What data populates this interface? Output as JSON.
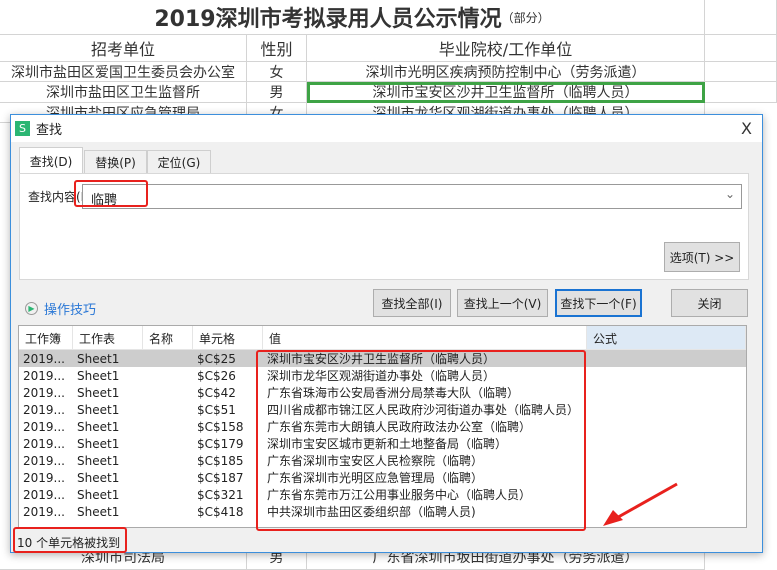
{
  "sheet": {
    "title": "2019深圳市考拟录用人员公示情况",
    "title_suffix": "（部分）",
    "headers": [
      "招考单位",
      "性别",
      "毕业院校/工作单位"
    ],
    "rows": [
      [
        "深圳市盐田区爱国卫生委员会办公室",
        "女",
        "深圳市光明区疾病预防控制中心（劳务派遣）"
      ],
      [
        "深圳市盐田区卫生监督所",
        "男",
        "深圳市宝安区沙井卫生监督所（临聘人员）"
      ],
      [
        "深圳市盐田区应急管理局",
        "女",
        "深圳市龙华区观湖街道办事处（临聘人员）"
      ]
    ],
    "bottom_row": [
      "深圳市司法局",
      "男",
      "广东省深圳市坂田街道办事处（劳务派遣）"
    ],
    "accent": "#3ea345"
  },
  "dialog": {
    "title": "查找",
    "logo": "S",
    "close": "X",
    "tabs": [
      "查找(D)",
      "替换(P)",
      "定位(G)"
    ],
    "find_label": "查找内容(N)",
    "find_value": "临聘",
    "options_button": "选项(T) >>",
    "tips_link": "操作技巧",
    "buttons": {
      "find_all": "查找全部(I)",
      "find_prev": "查找上一个(V)",
      "find_next": "查找下一个(F)",
      "close": "关闭"
    },
    "columns": [
      "工作簿",
      "工作表",
      "名称",
      "单元格",
      "值",
      "公式"
    ],
    "results": [
      [
        "2019...",
        "Sheet1",
        "",
        "$C$25",
        "深圳市宝安区沙井卫生监督所（临聘人员）"
      ],
      [
        "2019...",
        "Sheet1",
        "",
        "$C$26",
        "深圳市龙华区观湖街道办事处（临聘人员）"
      ],
      [
        "2019...",
        "Sheet1",
        "",
        "$C$42",
        "广东省珠海市公安局香洲分局禁毒大队（临聘）"
      ],
      [
        "2019...",
        "Sheet1",
        "",
        "$C$51",
        "四川省成都市锦江区人民政府沙河街道办事处（临聘人员）"
      ],
      [
        "2019...",
        "Sheet1",
        "",
        "$C$158",
        "广东省东莞市大朗镇人民政府政法办公室（临聘）"
      ],
      [
        "2019...",
        "Sheet1",
        "",
        "$C$179",
        "深圳市宝安区城市更新和土地整备局（临聘）"
      ],
      [
        "2019...",
        "Sheet1",
        "",
        "$C$185",
        "广东省深圳市宝安区人民检察院（临聘）"
      ],
      [
        "2019...",
        "Sheet1",
        "",
        "$C$187",
        "广东省深圳市光明区应急管理局（临聘）"
      ],
      [
        "2019...",
        "Sheet1",
        "",
        "$C$321",
        "广东省东莞市万江公用事业服务中心（临聘人员）"
      ],
      [
        "2019...",
        "Sheet1",
        "",
        "$C$418",
        "中共深圳市盐田区委组织部（临聘人员)"
      ]
    ],
    "status": "10 个单元格被找到",
    "highlight_color": "#e8211d"
  }
}
